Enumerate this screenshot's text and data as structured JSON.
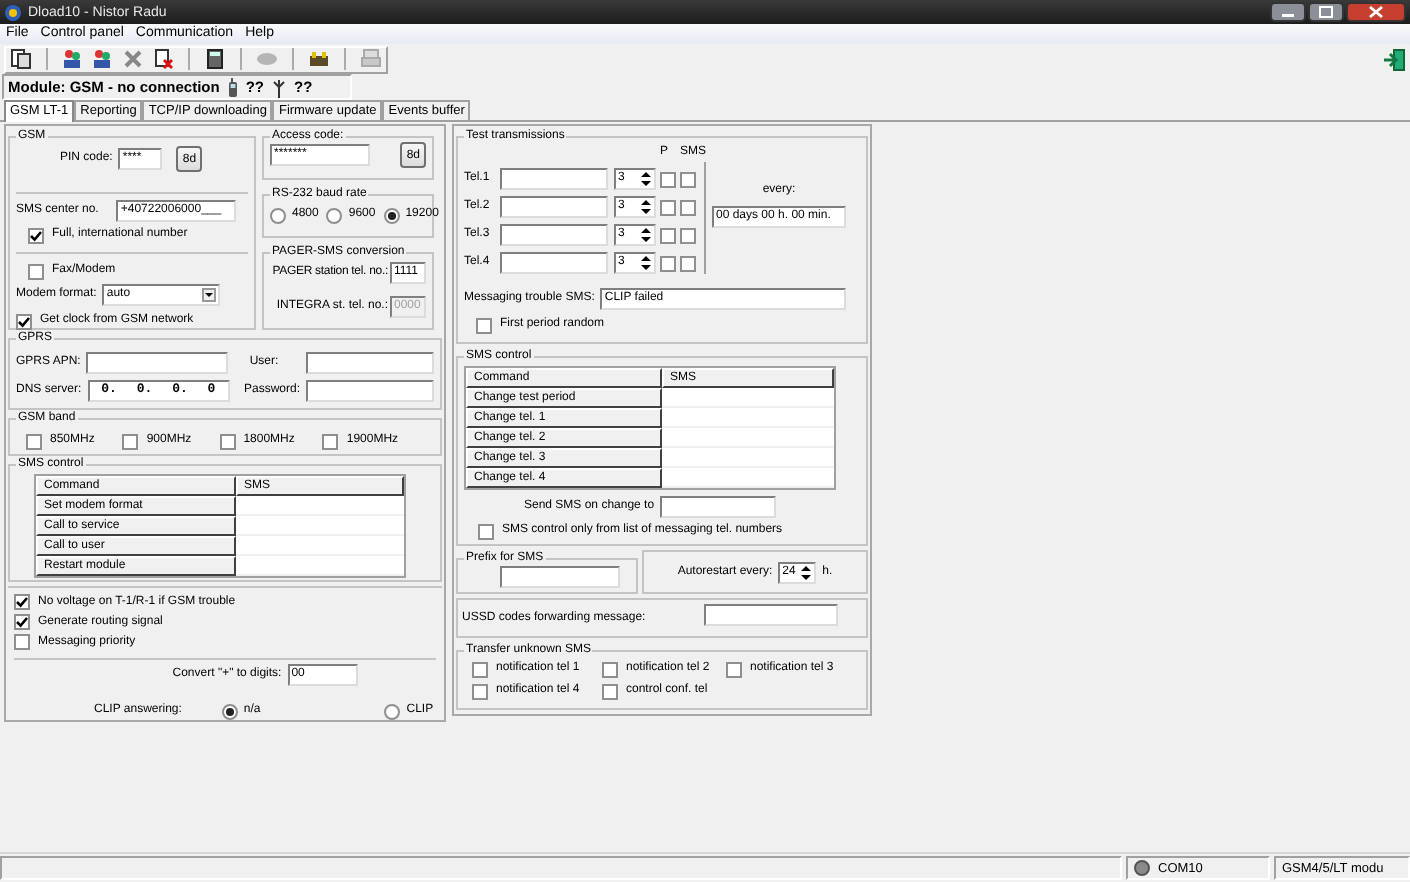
{
  "window": {
    "title": "Dload10 - Nistor Radu"
  },
  "menu": [
    "File",
    "Control panel",
    "Communication",
    "Help"
  ],
  "module": {
    "status": "Module: GSM - no connection",
    "signal": "??",
    "antenna": "??"
  },
  "tabs": [
    {
      "label": "GSM LT-1",
      "selected": true
    },
    {
      "label": "Reporting",
      "selected": false
    },
    {
      "label": "TCP/IP downloading",
      "selected": false
    },
    {
      "label": "Firmware update",
      "selected": false
    },
    {
      "label": "Events buffer",
      "selected": false
    }
  ],
  "gsm": {
    "title": "GSM",
    "pin_label": "PIN code:",
    "pin_value": "****",
    "pin_button": "8d",
    "sms_center_label": "SMS center no.",
    "sms_center_value": "+40722006000___",
    "full_international": {
      "label": "Full, international number",
      "checked": true
    },
    "fax_modem": {
      "label": "Fax/Modem",
      "checked": false
    },
    "modem_format_label": "Modem format:",
    "modem_format_value": "auto",
    "gsm_clock": {
      "label": "Get clock from GSM network",
      "checked": true
    }
  },
  "access": {
    "title": "Access code:",
    "value": "*******",
    "button": "8d"
  },
  "baud": {
    "title": "RS-232 baud rate",
    "options": [
      {
        "label": "4800",
        "selected": false
      },
      {
        "label": "9600",
        "selected": false
      },
      {
        "label": "19200",
        "selected": true
      }
    ]
  },
  "pager": {
    "title": "PAGER-SMS conversion",
    "pager_label": "PAGER station tel. no.:",
    "pager_value": "1111",
    "integra_label": "INTEGRA st. tel. no.:",
    "integra_value": "0000",
    "integra_disabled": true
  },
  "gprs": {
    "title": "GPRS",
    "apn_label": "GPRS APN:",
    "user_label": "User:",
    "dns_label": "DNS server:",
    "dns_parts": [
      "0.",
      "0.",
      "0.",
      "0"
    ],
    "password_label": "Password:"
  },
  "gsm_band": {
    "title": "GSM band",
    "bands": [
      {
        "label": "850MHz",
        "checked": false
      },
      {
        "label": "900MHz",
        "checked": false
      },
      {
        "label": "1800MHz",
        "checked": false
      },
      {
        "label": "1900MHz",
        "checked": false
      }
    ]
  },
  "sms_control_left": {
    "title": "SMS control",
    "columns": [
      "Command",
      "SMS"
    ],
    "rows": [
      "Set modem format",
      "Call to service",
      "Call to user",
      "Restart  module"
    ]
  },
  "options": [
    {
      "label": "No voltage on T-1/R-1 if GSM trouble",
      "checked": true
    },
    {
      "label": "Generate routing signal",
      "checked": true
    },
    {
      "label": "Messaging priority",
      "checked": false
    }
  ],
  "convert": {
    "label": "Convert \"+\" to digits:",
    "value": "00"
  },
  "clip": {
    "label": "CLIP answering:",
    "options": [
      {
        "label": "n/a",
        "selected": true
      },
      {
        "label": "CLIP",
        "selected": false
      }
    ]
  },
  "test": {
    "title": "Test transmissions",
    "p_header": "P",
    "sms_header": "SMS",
    "phones": [
      {
        "label": "Tel.1",
        "count": "3",
        "p": false,
        "sms": false
      },
      {
        "label": "Tel.2",
        "count": "3",
        "p": false,
        "sms": false
      },
      {
        "label": "Tel.3",
        "count": "3",
        "p": false,
        "sms": false
      },
      {
        "label": "Tel.4",
        "count": "3",
        "p": false,
        "sms": false
      }
    ],
    "every_label": "every:",
    "every_value": "00 days 00 h. 00 min.",
    "trouble_label": "Messaging trouble SMS:",
    "trouble_value": "CLIP failed",
    "first_random": {
      "label": "First period random",
      "checked": false
    }
  },
  "sms_control_right": {
    "title": "SMS control",
    "columns": [
      "Command",
      "SMS"
    ],
    "rows": [
      "Change test period",
      "Change tel. 1",
      "Change tel. 2",
      "Change tel. 3",
      "Change tel. 4"
    ],
    "send_label": "Send SMS on change to",
    "only_list": {
      "label": "SMS control only from list of messaging tel. numbers",
      "checked": false
    }
  },
  "prefix": {
    "title": "Prefix for SMS"
  },
  "autorestart": {
    "label": "Autorestart every:",
    "value": "24",
    "unit": "h."
  },
  "ussd": {
    "label": "USSD codes forwarding message:"
  },
  "transfer": {
    "title": "Transfer unknown SMS",
    "options": [
      {
        "label": "notification tel 1",
        "checked": false
      },
      {
        "label": "notification tel 2",
        "checked": false
      },
      {
        "label": "notification tel 3",
        "checked": false
      },
      {
        "label": "notification tel 4",
        "checked": false
      },
      {
        "label": "control conf. tel",
        "checked": false
      }
    ]
  },
  "status_bar": [
    "COM10",
    "GSM4/5/LT modu"
  ]
}
